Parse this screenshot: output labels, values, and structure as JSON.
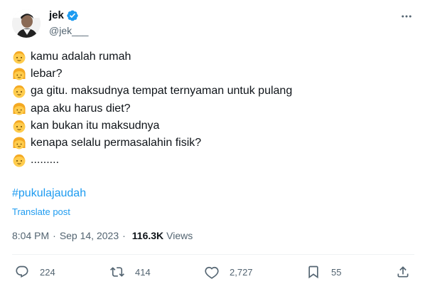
{
  "user": {
    "display_name": "jek",
    "handle": "@jek___",
    "verified_icon": "verified-badge-icon",
    "avatar_icon": "avatar"
  },
  "tweet_lines": [
    {
      "emoji": "child-face-emoji",
      "text": "kamu adalah rumah"
    },
    {
      "emoji": "girl-face-emoji",
      "text": "lebar?"
    },
    {
      "emoji": "child-face-emoji",
      "text": "ga gitu. maksudnya tempat ternyaman untuk pulang"
    },
    {
      "emoji": "girl-face-emoji",
      "text": "apa aku harus diet?"
    },
    {
      "emoji": "child-face-emoji",
      "text": "kan bukan itu maksudnya"
    },
    {
      "emoji": "girl-face-emoji",
      "text": "kenapa selalu permasalahin fisik?"
    },
    {
      "emoji": "child-face-emoji",
      "text": "........."
    }
  ],
  "hashtag": "#pukulajaudah",
  "translate_label": "Translate post",
  "meta": {
    "time": "8:04 PM",
    "separator": "·",
    "date": "Sep 14, 2023",
    "views_count": "116.3K",
    "views_label": "Views"
  },
  "actions": {
    "reply_count": "224",
    "repost_count": "414",
    "like_count": "2,727",
    "bookmark_count": "55"
  },
  "colors": {
    "accent": "#1d9bf0",
    "text": "#0f1419",
    "muted": "#536471",
    "divider": "#eff3f4"
  }
}
